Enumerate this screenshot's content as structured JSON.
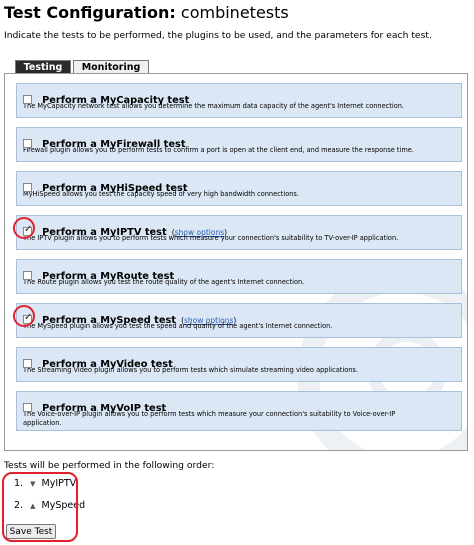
{
  "page": {
    "title_bold": "Test Configuration:",
    "title_name": "combinetests",
    "intro": "Indicate the tests to be performed, the plugins to be used, and the parameters for each test."
  },
  "tabs": [
    {
      "label": "Testing",
      "active": true
    },
    {
      "label": "Monitoring",
      "active": false
    }
  ],
  "tests": [
    {
      "title": "Perform a MyCapacity test",
      "checked": false,
      "options_link": "",
      "desc": "The MyCapacity network test allows you determine the maximum data capacity of the agent's Internet connection."
    },
    {
      "title": "Perform a MyFirewall test",
      "checked": false,
      "options_link": "",
      "desc": "Firewall plugin allows you to perform tests to confirm a port is open at the client end, and measure the response time."
    },
    {
      "title": "Perform a MyHiSpeed test",
      "checked": false,
      "options_link": "",
      "desc": "MyHiSpeed allows you test the capacity speed of very high bandwidth connections."
    },
    {
      "title": "Perform a MyIPTV test",
      "checked": true,
      "options_link": "show options",
      "desc": "The IPTV plugin allows you to perform tests which measure your connection's suitability to TV-over-IP application."
    },
    {
      "title": "Perform a MyRoute test",
      "checked": false,
      "options_link": "",
      "desc": "The Route plugin allows you test the route quality of the agent's Internet connection."
    },
    {
      "title": "Perform a MySpeed test",
      "checked": true,
      "options_link": "show options",
      "desc": "The MySpeed plugin allows you test the speed and quality of the agent's Internet connection."
    },
    {
      "title": "Perform a MyVideo test",
      "checked": false,
      "options_link": "",
      "desc": "The Streaming Video plugin allows you to perform tests which simulate streaming video applications."
    },
    {
      "title": "Perform a MyVoIP test",
      "checked": false,
      "options_link": "",
      "desc": "The Voice-over-IP plugin allows you to perform tests which measure your connection's suitability to Voice-over-IP",
      "desc2": "application."
    }
  ],
  "order": {
    "label": "Tests will be performed in the following order:",
    "items": [
      {
        "num": "1.",
        "arrow": "down-arrow-icon",
        "name": "MyIPTV"
      },
      {
        "num": "2.",
        "arrow": "up-arrow-icon",
        "name": "MySpeed"
      }
    ]
  },
  "save_label": "Save Test",
  "colors": {
    "highlight": "#e0202a",
    "box_bg": "#dbe7f5",
    "link": "#2a5db0"
  }
}
